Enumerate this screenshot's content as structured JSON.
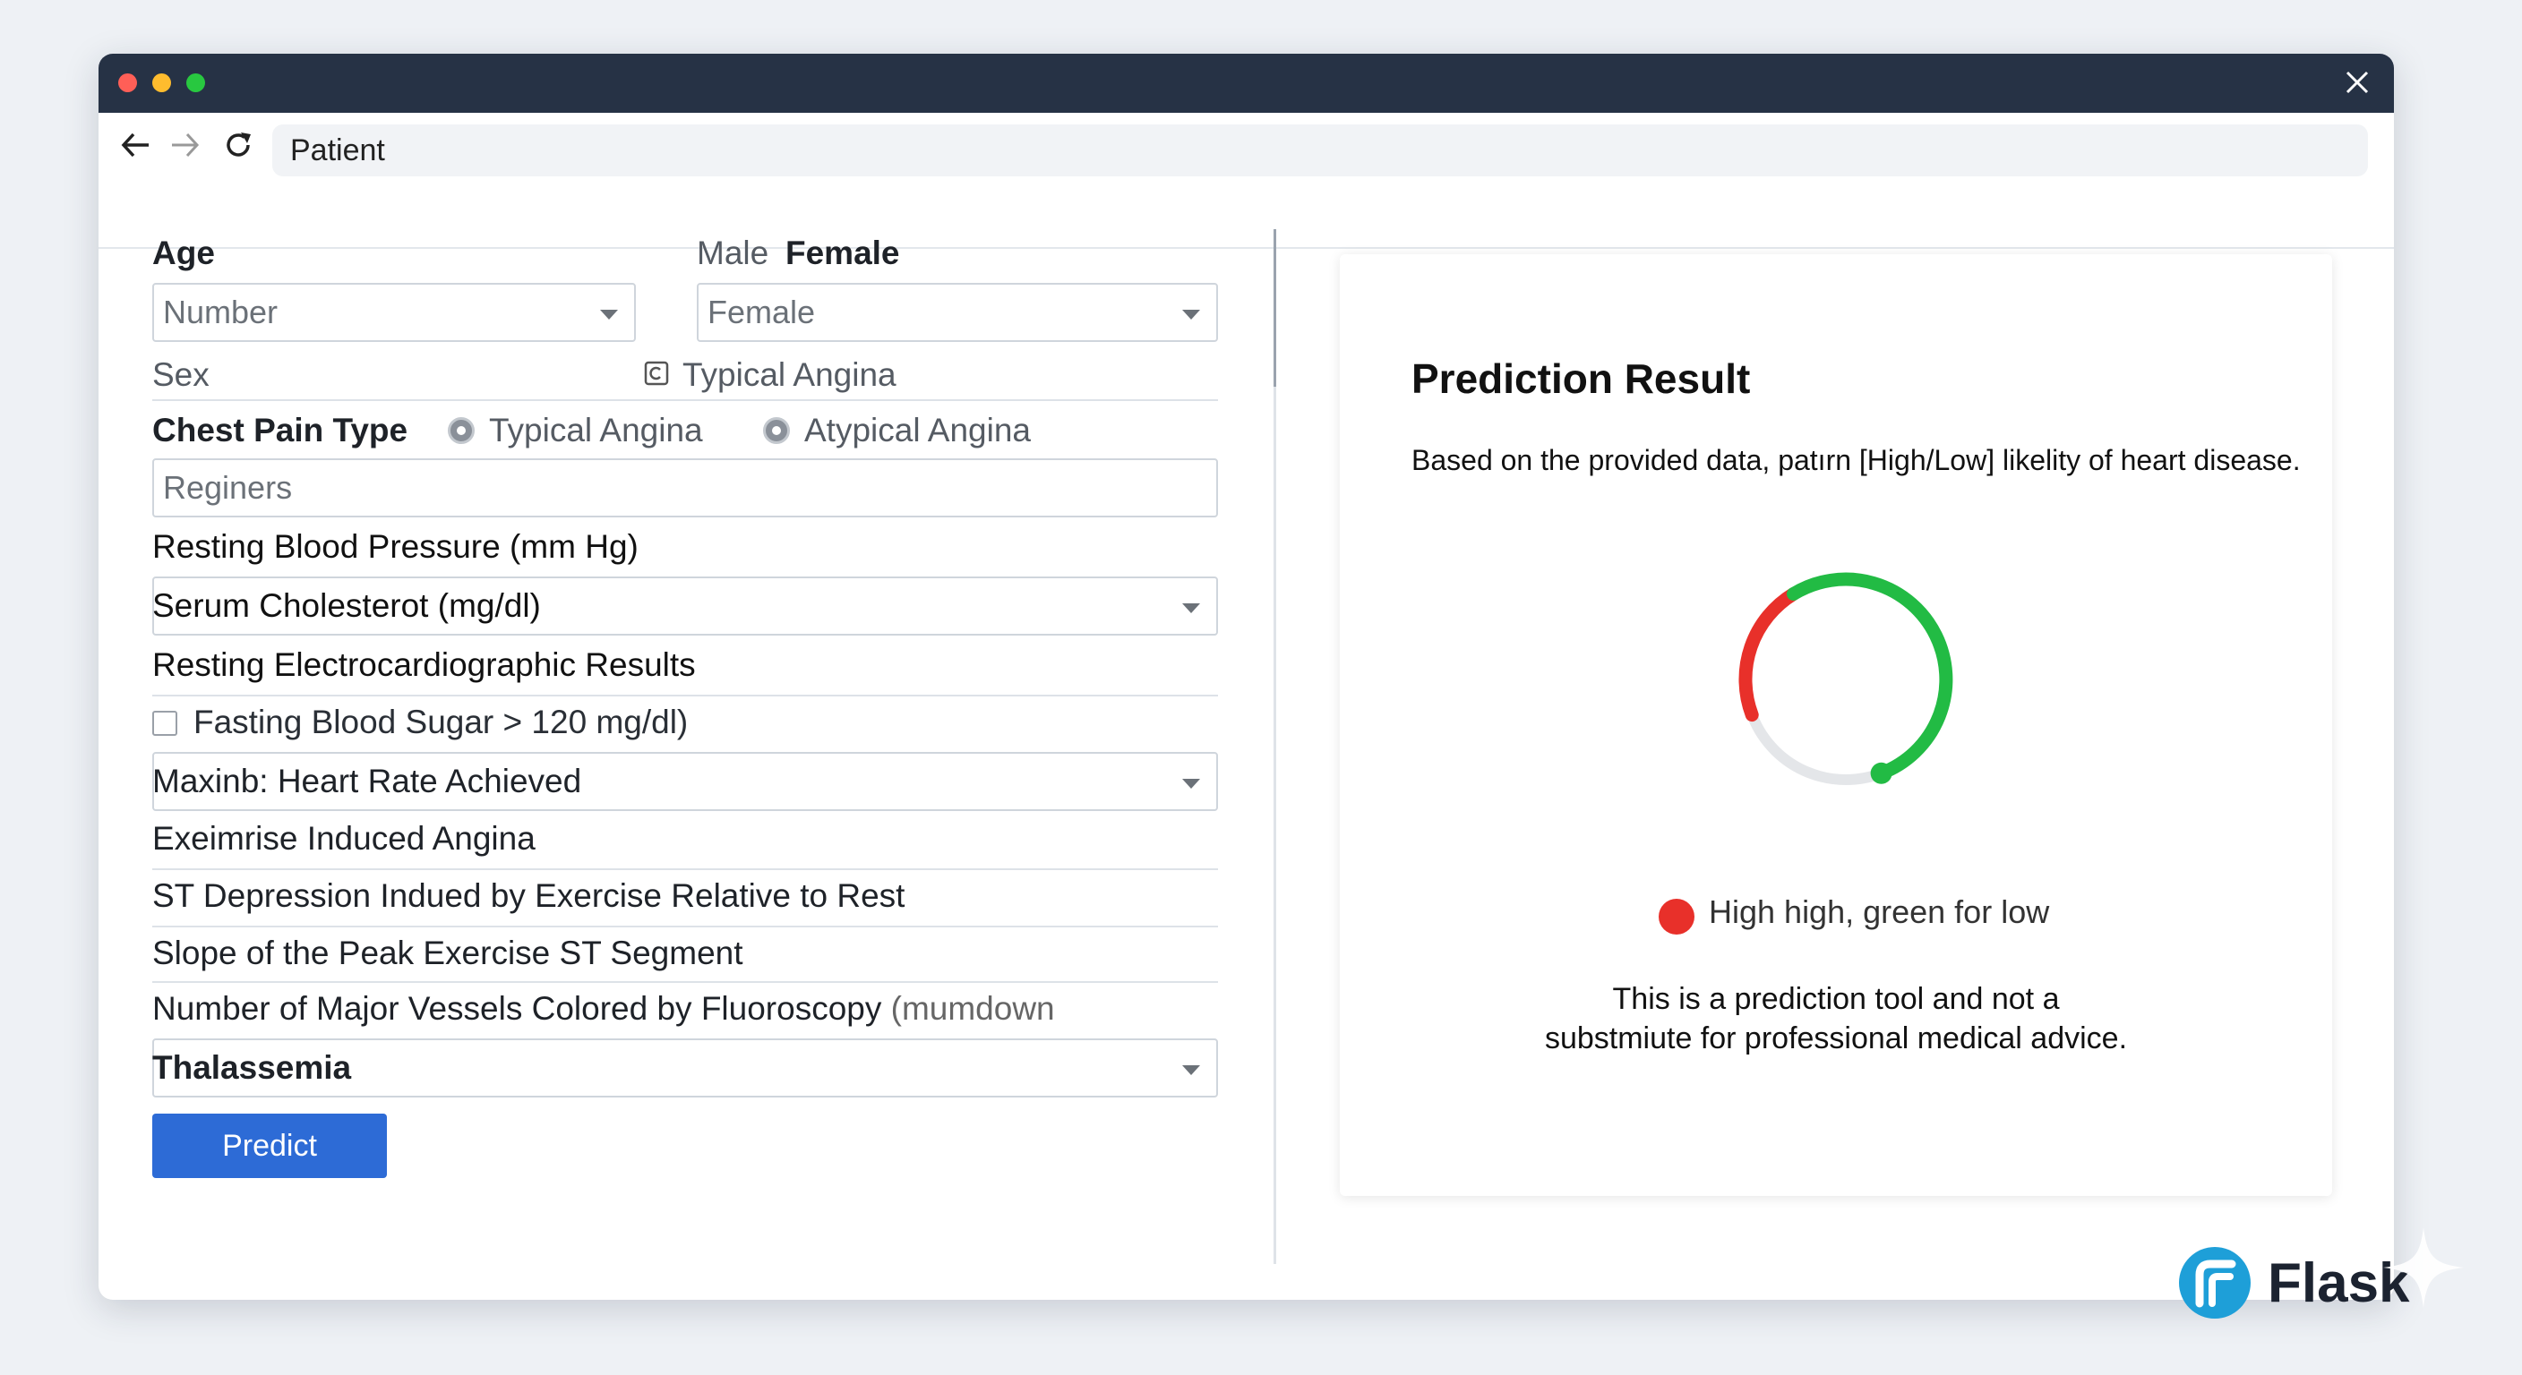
{
  "window": {
    "controls": {
      "close": "#ff5f57",
      "minimize": "#febc2e",
      "maximize": "#28c840"
    },
    "colors": {
      "titlebar": "#263245",
      "accent": "#2d6bd6",
      "high": "#e8302a",
      "low": "#22bb44"
    }
  },
  "browser": {
    "url": "Patient",
    "icons": [
      "back-arrow-icon",
      "forward-arrow-icon",
      "reload-icon",
      "close-icon"
    ]
  },
  "form": {
    "age_label": "Age",
    "age_placeholder": "Number",
    "sex_option_male": "Male",
    "sex_option_female": "Female",
    "sex_select_value": "Female",
    "sex_label": "Sex",
    "sex_extra_option": "Typical Angina",
    "chest_pain_label": "Chest Pain Type",
    "chest_pain_options": [
      "Typical Angina",
      "Atypical Angina"
    ],
    "chest_pain_input_placeholder": "Reginers",
    "resting_bp_label": "Resting Blood Pressure (mm Hg)",
    "cholesterol_label": "Serum Cholesterot (mg/dl)",
    "ecg_label": "Resting Electrocardiographic Results",
    "fasting_bs_label": "Fasting Blood Sugar > 120 mg/dl)",
    "max_hr_label": "Maxinb: Heart Rate Achieved",
    "exercise_angina_label": "Exeimrise Induced Angina",
    "st_depression_label": "ST Depression Indued by Exercise Relative to Rest",
    "slope_label": "Slope of the Peak Exercise ST Segment",
    "vessels_label": "Number of Major Vessels Colored by Fluoroscopy",
    "vessels_suffix": "(mumdown",
    "thalassemia_label": "Thalassemia",
    "predict_button": "Predict"
  },
  "result": {
    "title": "Prediction Result",
    "description": "Based on the provided data, patırn [High/Low] likelity of heart disease.",
    "gauge_high_fraction": 0.22,
    "gauge_low_fraction": 0.53,
    "legend_text": "High high, green for low",
    "disclaimer_line1": "This is a prediction tool and not a",
    "disclaimer_line2": "substmiute for professional medical advice."
  },
  "brand": {
    "name": "Flask",
    "icon": "flask-logo-icon"
  }
}
